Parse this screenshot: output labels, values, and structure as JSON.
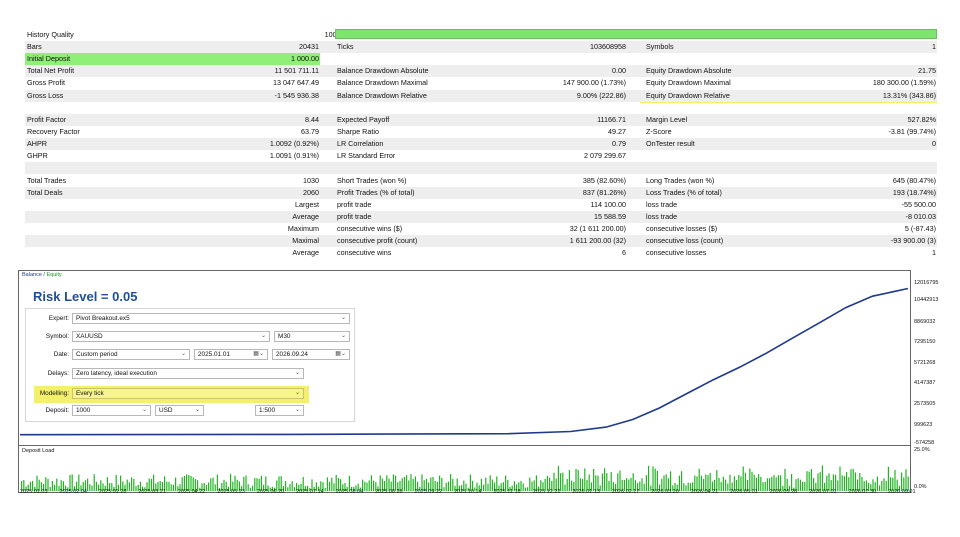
{
  "stats": {
    "history_quality": {
      "label": "History Quality",
      "value": "100%"
    },
    "rows": [
      {
        "c1l": "Bars",
        "c1v": "20431",
        "c2l": "Ticks",
        "c2v": "103608958",
        "c3l": "Symbols",
        "c3v": "1"
      },
      {
        "c1l": "Initial Deposit",
        "c1v": "1 000.00",
        "c2l": "",
        "c2v": "",
        "c3l": "",
        "c3v": ""
      },
      {
        "c1l": "Total Net Profit",
        "c1v": "11 501 711.11",
        "c2l": "Balance Drawdown Absolute",
        "c2v": "0.00",
        "c3l": "Equity Drawdown Absolute",
        "c3v": "21.75"
      },
      {
        "c1l": "Gross Profit",
        "c1v": "13 047 647.49",
        "c2l": "Balance Drawdown Maximal",
        "c2v": "147 900.00 (1.73%)",
        "c3l": "Equity Drawdown Maximal",
        "c3v": "180 300.00 (1.59%)"
      },
      {
        "c1l": "Gross Loss",
        "c1v": "-1 545 936.38",
        "c2l": "Balance Drawdown Relative",
        "c2v": "9.00% (222.86)",
        "c3l": "Equity Drawdown Relative",
        "c3v": "13.31% (343.86)"
      },
      {
        "c1l": "",
        "c1v": "",
        "c2l": "",
        "c2v": "",
        "c3l": "",
        "c3v": ""
      },
      {
        "c1l": "Profit Factor",
        "c1v": "8.44",
        "c2l": "Expected Payoff",
        "c2v": "11166.71",
        "c3l": "Margin Level",
        "c3v": "527.82%"
      },
      {
        "c1l": "Recovery Factor",
        "c1v": "63.79",
        "c2l": "Sharpe Ratio",
        "c2v": "49.27",
        "c3l": "Z-Score",
        "c3v": "-3.81 (99.74%)"
      },
      {
        "c1l": "AHPR",
        "c1v": "1.0092 (0.92%)",
        "c2l": "LR Correlation",
        "c2v": "0.79",
        "c3l": "OnTester result",
        "c3v": "0"
      },
      {
        "c1l": "GHPR",
        "c1v": "1.0091 (0.91%)",
        "c2l": "LR Standard Error",
        "c2v": "2 079 299.67",
        "c3l": "",
        "c3v": ""
      },
      {
        "c1l": "",
        "c1v": "",
        "c2l": "",
        "c2v": "",
        "c3l": "",
        "c3v": ""
      },
      {
        "c1l": "Total Trades",
        "c1v": "1030",
        "c2l": "Short Trades (won %)",
        "c2v": "385 (82.60%)",
        "c3l": "Long Trades (won %)",
        "c3v": "645 (80.47%)"
      },
      {
        "c1l": "Total Deals",
        "c1v": "2060",
        "c2l": "Profit Trades (% of total)",
        "c2v": "837 (81.26%)",
        "c3l": "Loss Trades (% of total)",
        "c3v": "193 (18.74%)"
      },
      {
        "c1l": "",
        "c1v": "Largest",
        "c2l": "profit trade",
        "c2v": "114 100.00",
        "c3l": "loss trade",
        "c3v": "-55 500.00"
      },
      {
        "c1l": "",
        "c1v": "Average",
        "c2l": "profit trade",
        "c2v": "15 588.59",
        "c3l": "loss trade",
        "c3v": "-8 010.03"
      },
      {
        "c1l": "",
        "c1v": "Maximum",
        "c2l": "consecutive wins ($)",
        "c2v": "32 (1 611 200.00)",
        "c3l": "consecutive losses ($)",
        "c3v": "5 (-87.43)"
      },
      {
        "c1l": "",
        "c1v": "Maximal",
        "c2l": "consecutive profit (count)",
        "c2v": "1 611 200.00 (32)",
        "c3l": "consecutive loss (count)",
        "c3v": "-93 900.00 (3)"
      },
      {
        "c1l": "",
        "c1v": "Average",
        "c2l": "consecutive wins",
        "c2v": "6",
        "c3l": "consecutive losses",
        "c3v": "1"
      }
    ]
  },
  "chart": {
    "legend_balance": "Balance",
    "legend_sep": " / ",
    "legend_equity": "Equity",
    "risk_label": "Risk Level = 0.05",
    "deposit_load_label": "Deposit Load",
    "balance_color": "#1f3a8a",
    "load_color": "#22b322"
  },
  "chart_data": {
    "type": "line",
    "y_ticks": [
      "12016795",
      "10442913",
      "8869032",
      "7295150",
      "5721268",
      "4147387",
      "2573505",
      "999623",
      "-574258"
    ],
    "load_ticks": [
      "25.0%",
      "0.0%"
    ],
    "x_ticks": [
      "2025.01.03",
      "2025.02.04",
      "2025.02.28",
      "2025.03.21",
      "2025.04.22",
      "2025.05.23",
      "2025.06.20",
      "2025.07.14",
      "2025.08.04",
      "2025.08.28",
      "2025.09.22",
      "2025.10.14",
      "2025.11.18",
      "2025.12.22",
      "2026.01.13",
      "2026.02.17",
      "2026.03.20",
      "2026.04.21",
      "2026.05.01",
      "2026.05.28",
      "2026.07.01",
      "2026.07.30",
      "2026.09.01"
    ],
    "ylim": [
      -574258,
      12016795
    ],
    "balance_fraction_x": [
      0,
      0.3,
      0.55,
      0.62,
      0.66,
      0.69,
      0.72,
      0.75,
      0.78,
      0.81,
      0.84,
      0.87,
      0.9,
      0.93,
      0.96,
      1.0
    ],
    "balance_values": [
      1000,
      20000,
      80000,
      250000,
      600000,
      1200000,
      2100000,
      3200000,
      4300000,
      5300000,
      6400000,
      7600000,
      8800000,
      10000000,
      10900000,
      11502711
    ]
  },
  "settings": {
    "expert_label": "Expert:",
    "expert_value": "Pivot Breakout.ex5",
    "symbol_label": "Symbol:",
    "symbol_value": "XAUUSD",
    "period_value": "M30",
    "date_label": "Date:",
    "date_mode": "Custom period",
    "date_from": "2025.01.01",
    "date_to": "2026.09.24",
    "delays_label": "Delays:",
    "delays_value": "Zero latency, ideal execution",
    "modelling_label": "Modelling:",
    "modelling_value": "Every tick",
    "deposit_label": "Deposit:",
    "deposit_value": "1000",
    "currency_value": "USD",
    "leverage_value": "1:500"
  }
}
